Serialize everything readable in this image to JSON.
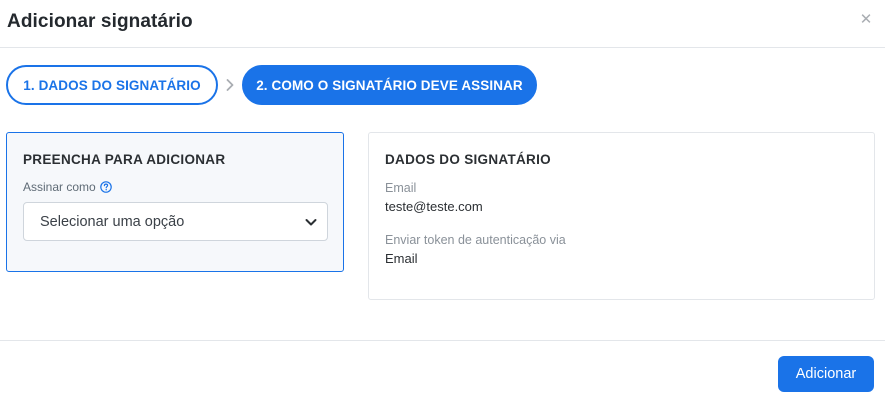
{
  "modal": {
    "title": "Adicionar signatário",
    "close_icon": "close-icon"
  },
  "steps": [
    {
      "label": "1. DADOS DO SIGNATÁRIO",
      "state": "completed"
    },
    {
      "label": "2. COMO O SIGNATÁRIO DEVE ASSINAR",
      "state": "active"
    }
  ],
  "form": {
    "heading": "PREENCHA PARA ADICIONAR",
    "field_label": "Assinar como",
    "help_icon": "help-circle-icon",
    "select_value": "Selecionar uma opção"
  },
  "signer_info": {
    "heading": "DADOS DO SIGNATÁRIO",
    "email_label": "Email",
    "email_value": "teste@teste.com",
    "token_label": "Enviar token de autenticação via",
    "token_value": "Email"
  },
  "footer": {
    "add_button": "Adicionar"
  },
  "colors": {
    "accent": "#1a73e8",
    "text": "#2b2f33",
    "muted": "#8a9199",
    "border": "#e3e6ea",
    "panel_bg": "#f6f8fb"
  }
}
